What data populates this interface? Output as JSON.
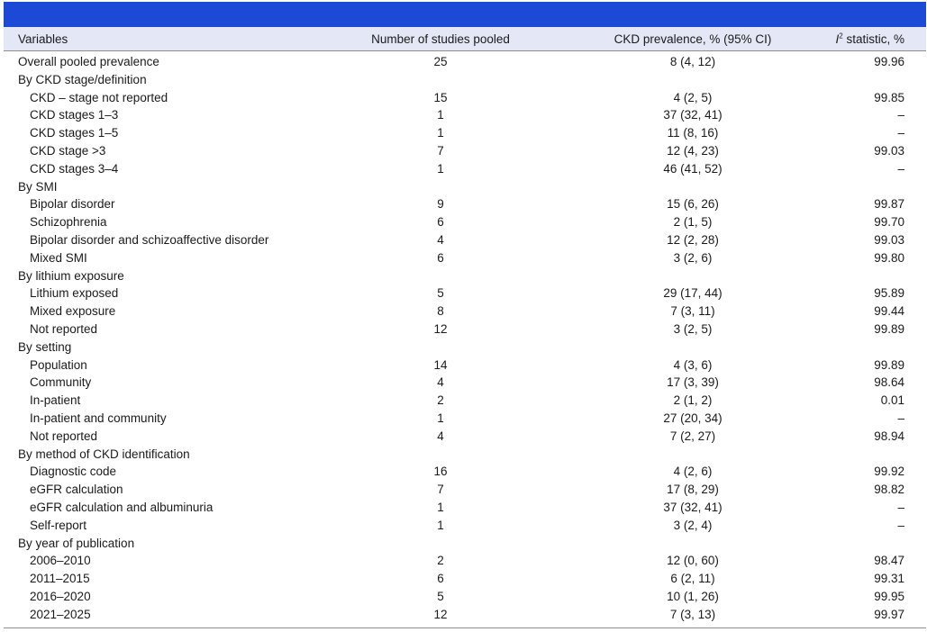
{
  "table": {
    "headers": {
      "variables": "Variables",
      "studies": "Number of studies pooled",
      "prevalence": "CKD prevalence, % (95% CI)",
      "i2_letter": "I",
      "i2_sup": "2",
      "i2_rest": " statistic, %"
    },
    "rows": [
      {
        "label": "Overall pooled prevalence",
        "indent": false,
        "studies": "25",
        "prev": "8 (4, 12)",
        "i2": "99.96"
      },
      {
        "label": "By CKD stage/definition",
        "indent": false,
        "studies": "",
        "prev": "",
        "i2": ""
      },
      {
        "label": "CKD – stage not reported",
        "indent": true,
        "studies": "15",
        "prev": "4 (2, 5)",
        "i2": "99.85"
      },
      {
        "label": "CKD stages 1–3",
        "indent": true,
        "studies": "1",
        "prev": "37 (32, 41)",
        "i2": "–"
      },
      {
        "label": "CKD stages 1–5",
        "indent": true,
        "studies": "1",
        "prev": "11 (8, 16)",
        "i2": "–"
      },
      {
        "label": "CKD stage >3",
        "indent": true,
        "studies": "7",
        "prev": "12 (4, 23)",
        "i2": "99.03"
      },
      {
        "label": "CKD stages 3–4",
        "indent": true,
        "studies": "1",
        "prev": "46 (41, 52)",
        "i2": "–"
      },
      {
        "label": "By SMI",
        "indent": false,
        "studies": "",
        "prev": "",
        "i2": ""
      },
      {
        "label": "Bipolar disorder",
        "indent": true,
        "studies": "9",
        "prev": "15 (6, 26)",
        "i2": "99.87"
      },
      {
        "label": "Schizophrenia",
        "indent": true,
        "studies": "6",
        "prev": "2 (1, 5)",
        "i2": "99.70"
      },
      {
        "label": "Bipolar disorder and schizoaffective disorder",
        "indent": true,
        "studies": "4",
        "prev": "12 (2, 28)",
        "i2": "99.03"
      },
      {
        "label": "Mixed SMI",
        "indent": true,
        "studies": "6",
        "prev": "3 (2, 6)",
        "i2": "99.80"
      },
      {
        "label": "By lithium exposure",
        "indent": false,
        "studies": "",
        "prev": "",
        "i2": ""
      },
      {
        "label": "Lithium exposed",
        "indent": true,
        "studies": "5",
        "prev": "29 (17, 44)",
        "i2": "95.89"
      },
      {
        "label": "Mixed exposure",
        "indent": true,
        "studies": "8",
        "prev": "7 (3, 11)",
        "i2": "99.44"
      },
      {
        "label": "Not reported",
        "indent": true,
        "studies": "12",
        "prev": "3 (2, 5)",
        "i2": "99.89"
      },
      {
        "label": "By setting",
        "indent": false,
        "studies": "",
        "prev": "",
        "i2": ""
      },
      {
        "label": "Population",
        "indent": true,
        "studies": "14",
        "prev": "4 (3, 6)",
        "i2": "99.89"
      },
      {
        "label": "Community",
        "indent": true,
        "studies": "4",
        "prev": "17 (3, 39)",
        "i2": "98.64"
      },
      {
        "label": "In-patient",
        "indent": true,
        "studies": "2",
        "prev": "2 (1, 2)",
        "i2": "0.01"
      },
      {
        "label": "In-patient and community",
        "indent": true,
        "studies": "1",
        "prev": "27 (20, 34)",
        "i2": "–"
      },
      {
        "label": "Not reported",
        "indent": true,
        "studies": "4",
        "prev": "7 (2, 27)",
        "i2": "98.94"
      },
      {
        "label": "By method of CKD identification",
        "indent": false,
        "studies": "",
        "prev": "",
        "i2": ""
      },
      {
        "label": "Diagnostic code",
        "indent": true,
        "studies": "16",
        "prev": "4 (2, 6)",
        "i2": "99.92"
      },
      {
        "label": "eGFR calculation",
        "indent": true,
        "studies": "7",
        "prev": "17 (8, 29)",
        "i2": "98.82"
      },
      {
        "label": "eGFR calculation and albuminuria",
        "indent": true,
        "studies": "1",
        "prev": "37 (32, 41)",
        "i2": "–"
      },
      {
        "label": "Self-report",
        "indent": true,
        "studies": "1",
        "prev": "3 (2, 4)",
        "i2": "–"
      },
      {
        "label": "By year of publication",
        "indent": false,
        "studies": "",
        "prev": "",
        "i2": ""
      },
      {
        "label": "2006–2010",
        "indent": true,
        "studies": "2",
        "prev": "12 (0, 60)",
        "i2": "98.47"
      },
      {
        "label": "2011–2015",
        "indent": true,
        "studies": "6",
        "prev": "6 (2, 11)",
        "i2": "99.31"
      },
      {
        "label": "2016–2020",
        "indent": true,
        "studies": "5",
        "prev": "10 (1, 26)",
        "i2": "99.95"
      },
      {
        "label": "2021–2025",
        "indent": true,
        "studies": "12",
        "prev": "7 (3, 13)",
        "i2": "99.97"
      }
    ]
  },
  "colors": {
    "title_bar": "#1c49d6",
    "header_background": "#e4e8f6"
  }
}
